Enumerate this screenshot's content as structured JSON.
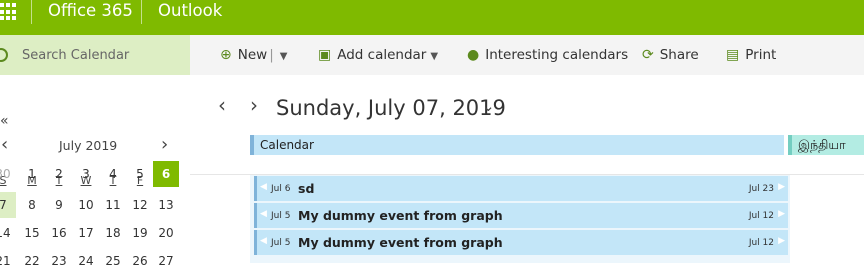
{
  "brand": {
    "suite": "Office 365",
    "app": "Outlook"
  },
  "colors": {
    "accent": "#7fba00",
    "event_fill": "#c3e6f8",
    "event_border": "#7fb3d9",
    "second_calendar": "#b3ece3"
  },
  "sidebar": {
    "search_placeholder": "Search Calendar",
    "collapse_glyph": "«",
    "mini_calendar": {
      "month_label": "July 2019",
      "prev_glyph": "‹",
      "next_glyph": "›",
      "weekdays": [
        "S",
        "M",
        "T",
        "W",
        "T",
        "F",
        "S"
      ],
      "weeks": [
        [
          "30",
          "1",
          "2",
          "3",
          "4",
          "5",
          "6"
        ],
        [
          "7",
          "8",
          "9",
          "10",
          "11",
          "12",
          "13"
        ],
        [
          "14",
          "15",
          "16",
          "17",
          "18",
          "19",
          "20"
        ],
        [
          "21",
          "22",
          "23",
          "24",
          "25",
          "26",
          "27"
        ]
      ],
      "today": "6",
      "selected": "7"
    }
  },
  "toolbar": {
    "new_label": "New",
    "add_calendar_label": "Add calendar",
    "interesting_label": "Interesting calendars",
    "share_label": "Share",
    "print_label": "Print"
  },
  "view": {
    "prev_glyph": "‹",
    "next_glyph": "›",
    "date_title": "Sunday, July 07, 2019",
    "calendars": [
      "Calendar",
      "இந்தியா"
    ]
  },
  "events": [
    {
      "start": "Jul 6",
      "title": "sd",
      "end": "Jul 23"
    },
    {
      "start": "Jul 5",
      "title": "My dummy event from graph",
      "end": "Jul 12"
    },
    {
      "start": "Jul 5",
      "title": "My dummy event from graph",
      "end": "Jul 12"
    }
  ]
}
